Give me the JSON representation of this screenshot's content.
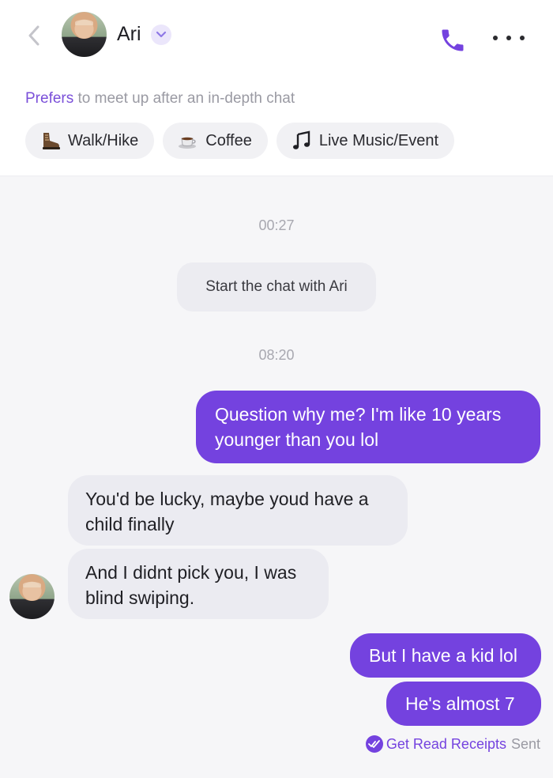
{
  "header": {
    "contact_name": "Ari",
    "icons": {
      "back": "chevron-left-icon",
      "verified": "chevron-down-icon",
      "call": "phone-icon",
      "more": "more-dots-icon"
    }
  },
  "preferences": {
    "highlight": "Prefers",
    "text": " to meet up after an in-depth chat",
    "chips": [
      {
        "label": "Walk/Hike",
        "icon": "boot-icon"
      },
      {
        "label": "Coffee",
        "icon": "coffee-cup-icon"
      },
      {
        "label": "Live Music/Event",
        "icon": "music-note-icon"
      }
    ]
  },
  "conversation": {
    "timestamps": [
      "00:27",
      "08:20"
    ],
    "system_message": "Start the chat with Ari",
    "messages": [
      {
        "sender": "me",
        "text": "Question why me? I'm like 10 years younger than you lol"
      },
      {
        "sender": "Ari",
        "text": "You'd be lucky, maybe youd have a child finally"
      },
      {
        "sender": "Ari",
        "text": "And I didnt pick you, I was blind swiping."
      },
      {
        "sender": "me",
        "text": "But I have a kid lol"
      },
      {
        "sender": "me",
        "text": "He's almost 7"
      }
    ],
    "read_receipts_label": "Get Read Receipts",
    "status": "Sent"
  },
  "colors": {
    "accent": "#7442df",
    "incoming_bubble": "#ebebf1",
    "muted_text": "#9a9aa3"
  }
}
